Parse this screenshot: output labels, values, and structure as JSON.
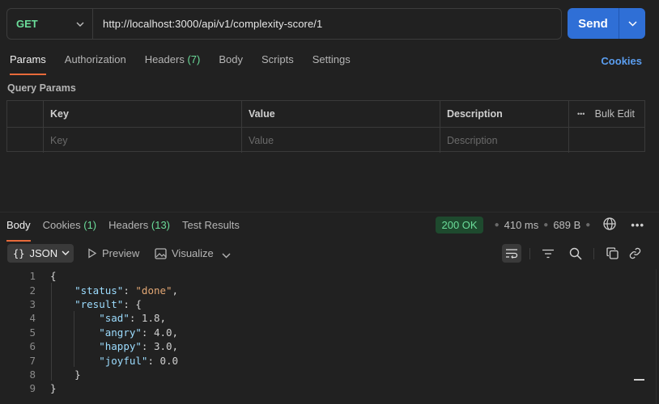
{
  "request": {
    "method": "GET",
    "url": "http://localhost:3000/api/v1/complexity-score/1",
    "send_label": "Send"
  },
  "request_tabs": [
    {
      "label": "Params",
      "count": ""
    },
    {
      "label": "Authorization",
      "count": ""
    },
    {
      "label": "Headers",
      "count": "(7)"
    },
    {
      "label": "Body",
      "count": ""
    },
    {
      "label": "Scripts",
      "count": ""
    },
    {
      "label": "Settings",
      "count": ""
    }
  ],
  "cookies_link": "Cookies",
  "query_params": {
    "title": "Query Params",
    "headers": {
      "key": "Key",
      "value": "Value",
      "description": "Description",
      "bulk_edit": "Bulk Edit",
      "more": "•••"
    },
    "placeholders": {
      "key": "Key",
      "value": "Value",
      "description": "Description"
    }
  },
  "response_tabs": [
    {
      "label": "Body",
      "count": ""
    },
    {
      "label": "Cookies",
      "count": "(1)"
    },
    {
      "label": "Headers",
      "count": "(13)"
    },
    {
      "label": "Test Results",
      "count": ""
    }
  ],
  "response_status": {
    "status": "200 OK",
    "time": "410 ms",
    "size": "689 B",
    "status_color": "#6bdd9a"
  },
  "response_toolbar": {
    "format": "JSON",
    "preview": "Preview",
    "visualize": "Visualize"
  },
  "code_lines": [
    {
      "n": "1",
      "t": "{"
    },
    {
      "n": "2",
      "t": "    \"status\": \"done\","
    },
    {
      "n": "3",
      "t": "    \"result\": {"
    },
    {
      "n": "4",
      "t": "        \"sad\": 1.8,"
    },
    {
      "n": "5",
      "t": "        \"angry\": 4.0,"
    },
    {
      "n": "6",
      "t": "        \"happy\": 3.0,"
    },
    {
      "n": "7",
      "t": "        \"joyful\": 0.0"
    },
    {
      "n": "8",
      "t": "    }"
    },
    {
      "n": "9",
      "t": "}"
    }
  ],
  "colors": {
    "accent": "#2f6fd6",
    "tab_underline": "#e86a3a",
    "link": "#5b9ef0"
  }
}
